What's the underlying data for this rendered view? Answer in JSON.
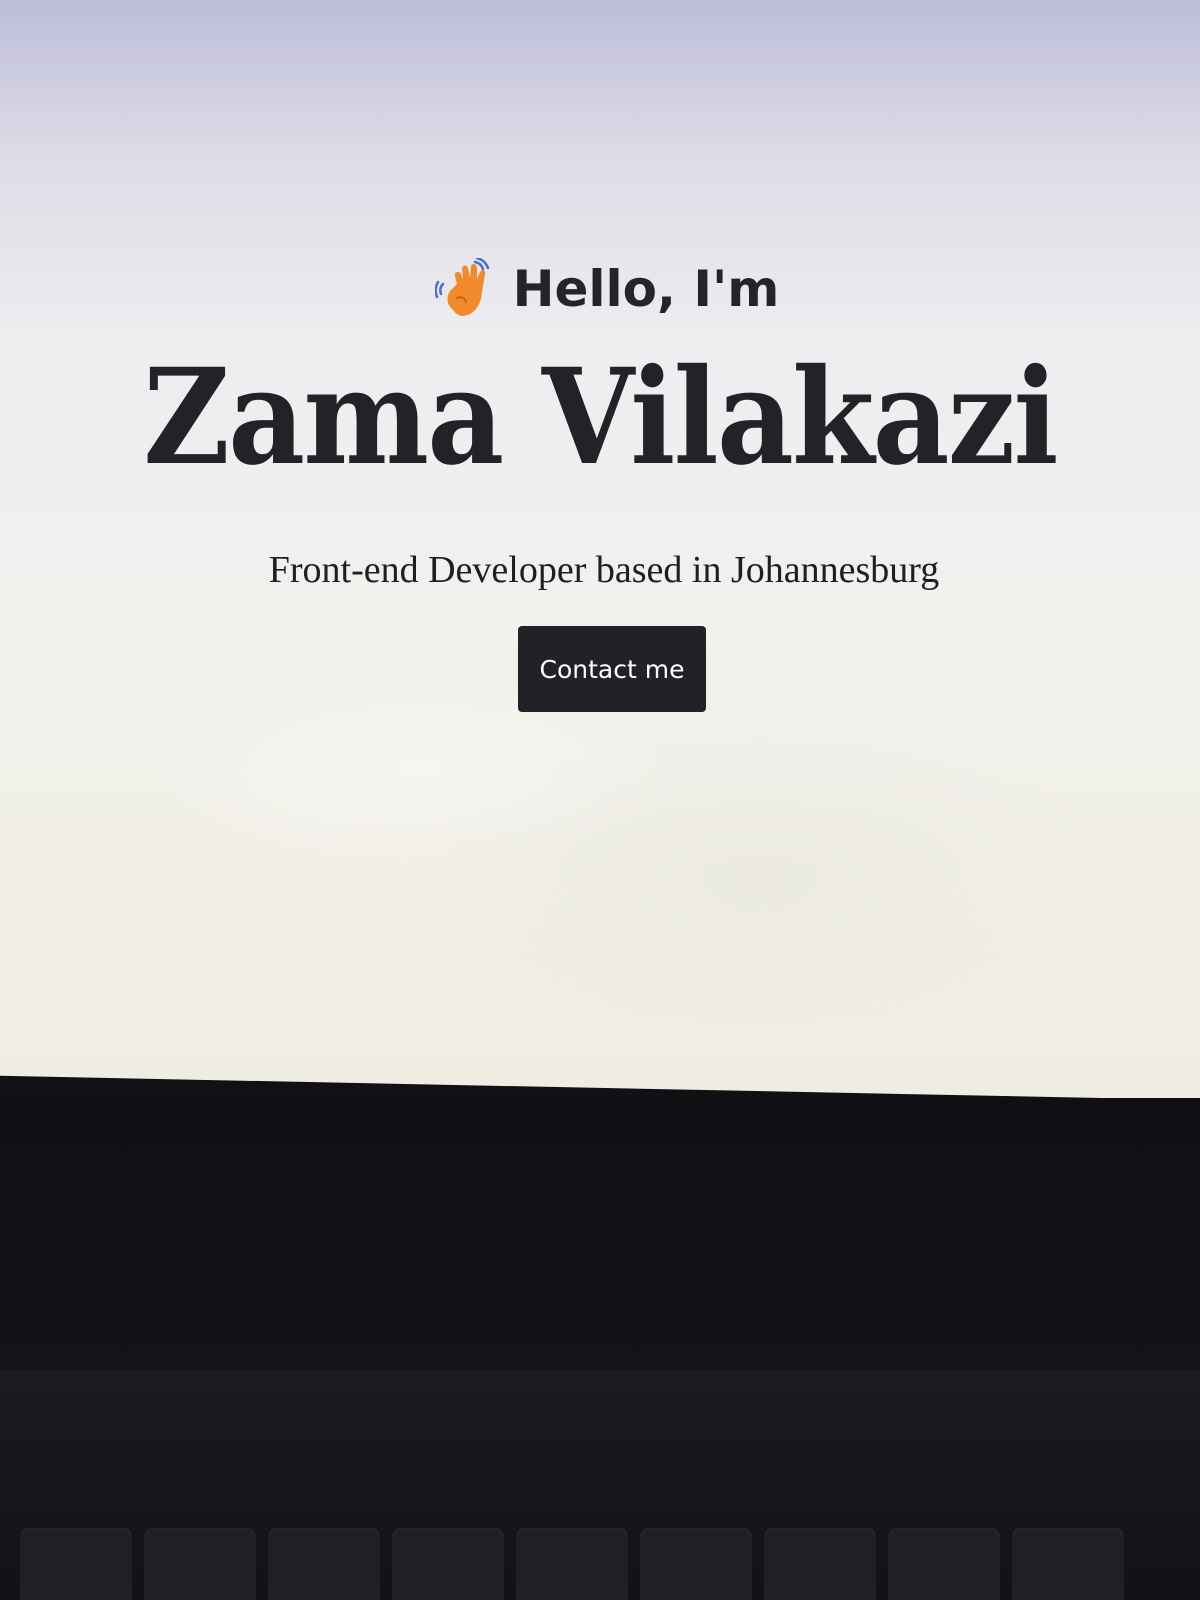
{
  "hero": {
    "greeting_icon": "waving-hand-icon",
    "greeting_text": "Hello, I'm",
    "name": "Zama Vilakazi",
    "tagline": "Front-end Developer based in Johannesburg",
    "contact_button_label": "Contact me"
  },
  "colors": {
    "text": "#232229",
    "button_bg": "#222125",
    "button_text": "#ffffff",
    "wave_accent": "#f08a2c"
  }
}
